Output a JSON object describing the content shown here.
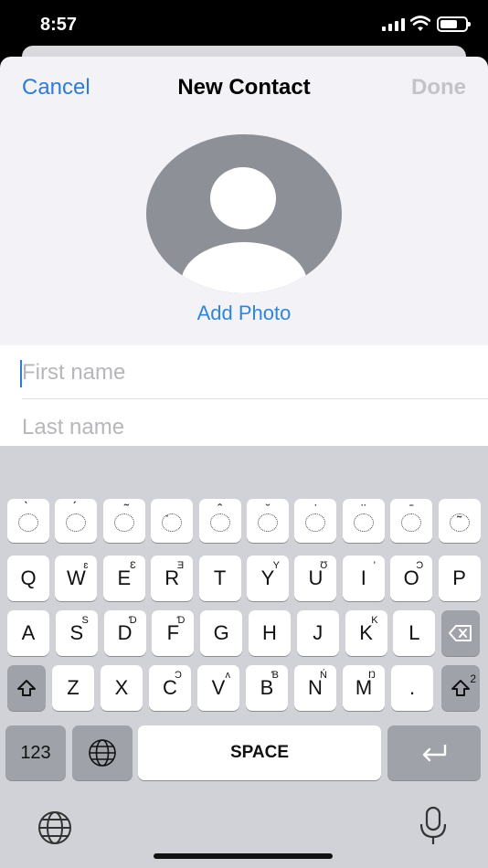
{
  "status_bar": {
    "time": "8:57"
  },
  "nav": {
    "cancel": "Cancel",
    "title": "New Contact",
    "done": "Done"
  },
  "photo": {
    "label": "Add Photo"
  },
  "fields": {
    "first_name_placeholder": "First name",
    "last_name_placeholder": "Last name"
  },
  "keyboard": {
    "diacritics": [
      "̀",
      "́",
      "̃",
      "̣",
      "̂",
      "̆",
      "̇",
      "̈",
      "̄",
      "̰"
    ],
    "row1": [
      {
        "label": "Q",
        "sup": ""
      },
      {
        "label": "W",
        "sup": "ɛ"
      },
      {
        "label": "E",
        "sup": "Ɛ"
      },
      {
        "label": "R",
        "sup": "Ǝ"
      },
      {
        "label": "T",
        "sup": ""
      },
      {
        "label": "Y",
        "sup": "Y"
      },
      {
        "label": "U",
        "sup": "Ʊ"
      },
      {
        "label": "I",
        "sup": "'"
      },
      {
        "label": "O",
        "sup": "Ɔ"
      },
      {
        "label": "P",
        "sup": ""
      }
    ],
    "row2": [
      {
        "label": "A",
        "sup": ""
      },
      {
        "label": "S",
        "sup": "S"
      },
      {
        "label": "D",
        "sup": "Ɗ"
      },
      {
        "label": "F",
        "sup": "Ɗ"
      },
      {
        "label": "G",
        "sup": ""
      },
      {
        "label": "H",
        "sup": ""
      },
      {
        "label": "J",
        "sup": ""
      },
      {
        "label": "K",
        "sup": "K"
      },
      {
        "label": "L",
        "sup": ""
      }
    ],
    "row3": [
      {
        "label": "Z",
        "sup": ""
      },
      {
        "label": "X",
        "sup": ""
      },
      {
        "label": "C",
        "sup": "Ɔ"
      },
      {
        "label": "V",
        "sup": "ʌ"
      },
      {
        "label": "B",
        "sup": "Ɓ"
      },
      {
        "label": "N",
        "sup": "Ń"
      },
      {
        "label": "M",
        "sup": "Ŋ"
      },
      {
        "label": ".",
        "sup": ""
      }
    ],
    "numbers_label": "123",
    "space_label": "SPACE",
    "shift2_sup": "2"
  }
}
